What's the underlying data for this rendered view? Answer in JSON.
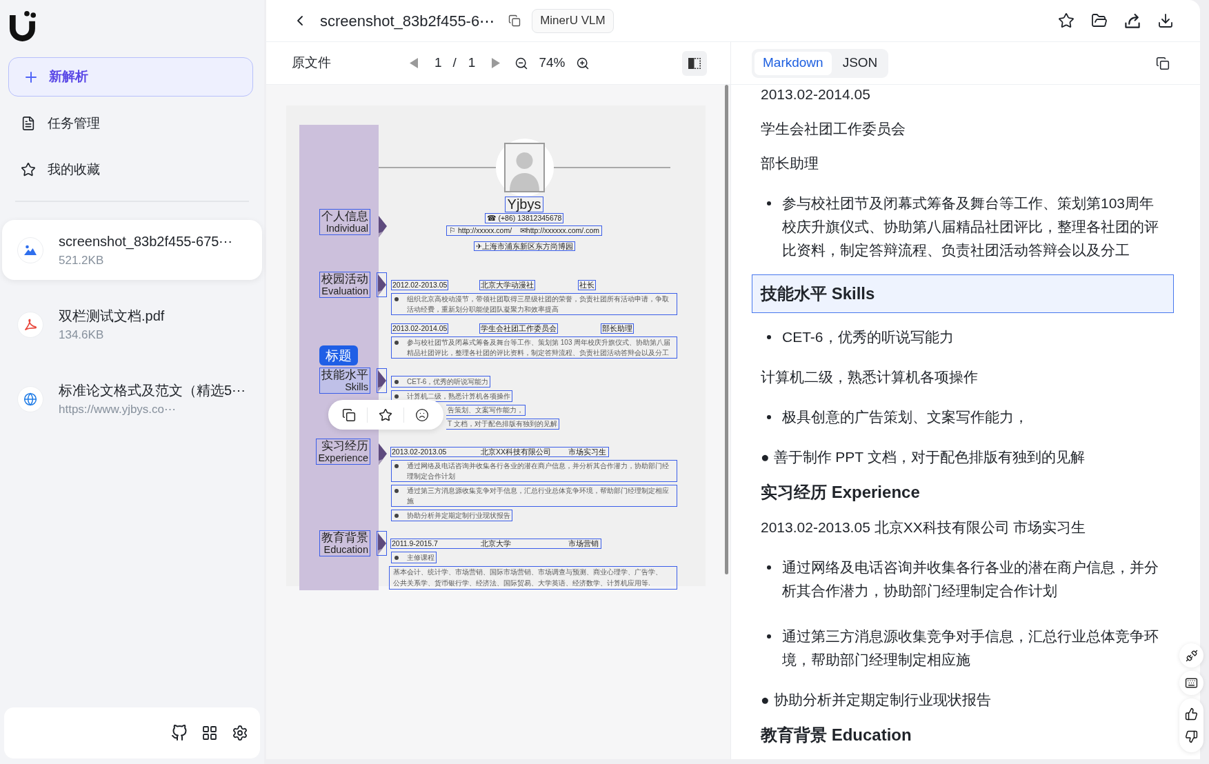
{
  "sidebar": {
    "new_button": "新解析",
    "nav": [
      {
        "label": "任务管理"
      },
      {
        "label": "我的收藏"
      }
    ],
    "files": [
      {
        "kind": "image",
        "name": "screenshot_83b2f455-675⋯",
        "meta": "521.2KB",
        "selected": true
      },
      {
        "kind": "pdf",
        "name": "双栏测试文档.pdf",
        "meta": "134.6KB",
        "selected": false
      },
      {
        "kind": "web",
        "name": "标准论文格式及范文（精选5⋯",
        "meta": "https://www.yjbys.co⋯",
        "selected": false
      }
    ]
  },
  "header": {
    "title": "screenshot_83b2f455-6⋯",
    "badge": "MinerU VLM"
  },
  "viewer": {
    "label": "原文件",
    "page": "1",
    "separator": "/",
    "page_count": "1",
    "zoom": "74%"
  },
  "document": {
    "selection_tag": "标题",
    "sections": [
      {
        "kind": "profile",
        "title": "个人信息",
        "subtitle": "Individual",
        "selected": false,
        "arrow_boxed": false,
        "name": "Yjbys",
        "phone": "☎ (+86) 13812345678",
        "links": "⚐ http://xxxxx.com/    ✉http://xxxxxx.com/.com",
        "address": "✈上海市浦东新区东方尚博园"
      },
      {
        "kind": "list",
        "title": "校园活动",
        "subtitle": "Evaluation",
        "selected": false,
        "arrow_boxed": true,
        "items": [
          {
            "kind": "head_split",
            "parts": [
              "2012.02-2013.05",
              "北京大学动漫社",
              "社长"
            ]
          },
          {
            "kind": "bullet",
            "text": "组织北京高校动漫节，带领社团取得三星级社团的荣誉，负责社团所有活动申请，争取活动经费，重新划分职能使团队凝聚力和效率提高"
          },
          {
            "kind": "head_split",
            "parts": [
              "2013.02-2014.05",
              "学生会社团工作委员会",
              "部长助理"
            ]
          },
          {
            "kind": "bullet",
            "text": "参与校社团节及闭幕式筹备及舞台等工作、策划第 103 周年校庆升旗仪式、协助第八届精品社团评比，整理各社团的评比资料，制定答辩流程、负责社团活动答辩会以及分工"
          }
        ]
      },
      {
        "kind": "list",
        "title": "技能水平",
        "subtitle": "Skills",
        "selected": true,
        "arrow_boxed": true,
        "items": [
          {
            "kind": "bullet",
            "text": "CET-6，优秀的听说写能力"
          },
          {
            "kind": "bullet",
            "text": "计算机二级，熟悉计算机各项操作"
          },
          {
            "kind": "clipped",
            "text": "告策划、文案写作能力，"
          },
          {
            "kind": "clipped",
            "text": "T 文档，对于配色排版有独到的见解"
          }
        ]
      },
      {
        "kind": "list",
        "title": "实习经历",
        "subtitle": "Experience",
        "selected": false,
        "arrow_boxed": false,
        "items": [
          {
            "kind": "head_merged",
            "parts": [
              "2013.02-2013.05",
              "北京XX科技有限公司",
              "市场实习生"
            ]
          },
          {
            "kind": "bullet",
            "text": "通过网络及电话咨询并收集各行各业的潜在商户信息，并分析其合作潜力，协助部门经理制定合作计划"
          },
          {
            "kind": "bullet",
            "text": "通过第三方消息源收集竞争对手信息，汇总行业总体竞争环境，帮助部门经理制定相应施"
          },
          {
            "kind": "bullet",
            "text": "协助分析并定期定制行业现状报告"
          }
        ]
      },
      {
        "kind": "list",
        "title": "教育背景",
        "subtitle": "Education",
        "selected": false,
        "arrow_boxed": true,
        "items": [
          {
            "kind": "head_merged",
            "parts": [
              "2011.9-2015.7",
              "北京大学",
              "市场营销"
            ]
          },
          {
            "kind": "bullet",
            "text": "主修课程"
          },
          {
            "kind": "plain",
            "text": "基本会计、统计学、市场营销、国际市场营销、市场调查与预测、商业心理学、广告学、公共关系学、货币银行学、经济法、国际贸易、大学英语、经济数学、计算机应用等."
          }
        ]
      }
    ]
  },
  "result": {
    "tabs": [
      {
        "label": "Markdown",
        "selected": true
      },
      {
        "label": "JSON",
        "selected": false
      }
    ],
    "blocks": [
      {
        "kind": "paragraph",
        "text": "2013.02-2014.05",
        "selected": false
      },
      {
        "kind": "paragraph",
        "text": "学生会社团工作委员会",
        "selected": false
      },
      {
        "kind": "paragraph",
        "text": "部长助理",
        "selected": false
      },
      {
        "kind": "bullet",
        "text": "参与校社团节及闭幕式筹备及舞台等工作、策划第103周年校庆升旗仪式、协助第八届精品社团评比，整理各社团的评比资料，制定答辩流程、负责社团活动答辩会以及分工",
        "selected": false
      },
      {
        "kind": "heading",
        "text": "技能水平 Skills",
        "selected": true
      },
      {
        "kind": "bullet",
        "text": "CET-6，优秀的听说写能力",
        "selected": false
      },
      {
        "kind": "paragraph",
        "text": "计算机二级，熟悉计算机各项操作",
        "selected": false
      },
      {
        "kind": "bullet",
        "text": "极具创意的广告策划、文案写作能力，",
        "selected": false
      },
      {
        "kind": "paragraph",
        "text": "● 善于制作 PPT 文档，对于配色排版有独到的见解",
        "selected": false
      },
      {
        "kind": "heading",
        "text": "实习经历 Experience",
        "selected": false
      },
      {
        "kind": "paragraph",
        "text": "2013.02-2013.05 北京XX科技有限公司 市场实习生",
        "selected": false
      },
      {
        "kind": "bullet",
        "text": "通过网络及电话咨询并收集各行各业的潜在商户信息，并分析其合作潜力，协助部门经理制定合作计划",
        "selected": false
      },
      {
        "kind": "bullet",
        "text": "通过第三方消息源收集竞争对手信息，汇总行业总体竞争环境，帮助部门经理制定相应施",
        "selected": false
      },
      {
        "kind": "paragraph",
        "text": "● 协助分析并定期定制行业现状报告",
        "selected": false
      },
      {
        "kind": "heading",
        "text": "教育背景 Education",
        "selected": false
      }
    ]
  }
}
